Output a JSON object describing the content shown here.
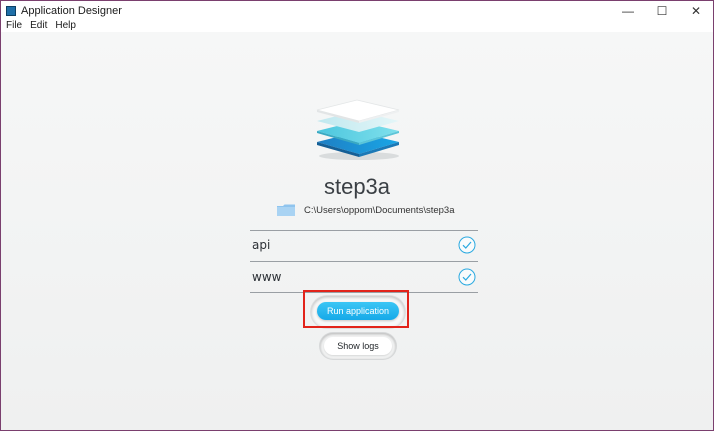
{
  "window": {
    "title": "Application Designer",
    "controls": {
      "minimize": "—",
      "maximize": "☐",
      "close": "✕"
    }
  },
  "menu": {
    "items": [
      "File",
      "Edit",
      "Help"
    ]
  },
  "project": {
    "name": "step3a",
    "path": "C:\\Users\\oppom\\Documents\\step3a",
    "items": [
      {
        "label": "api",
        "status_icon": "check-circle-icon"
      },
      {
        "label": "www",
        "status_icon": "check-circle-icon"
      }
    ]
  },
  "actions": {
    "run_label": "Run application",
    "logs_label": "Show logs"
  },
  "colors": {
    "accent": "#1aaeea",
    "highlight": "#e2231a",
    "check": "#2aa9e0"
  }
}
